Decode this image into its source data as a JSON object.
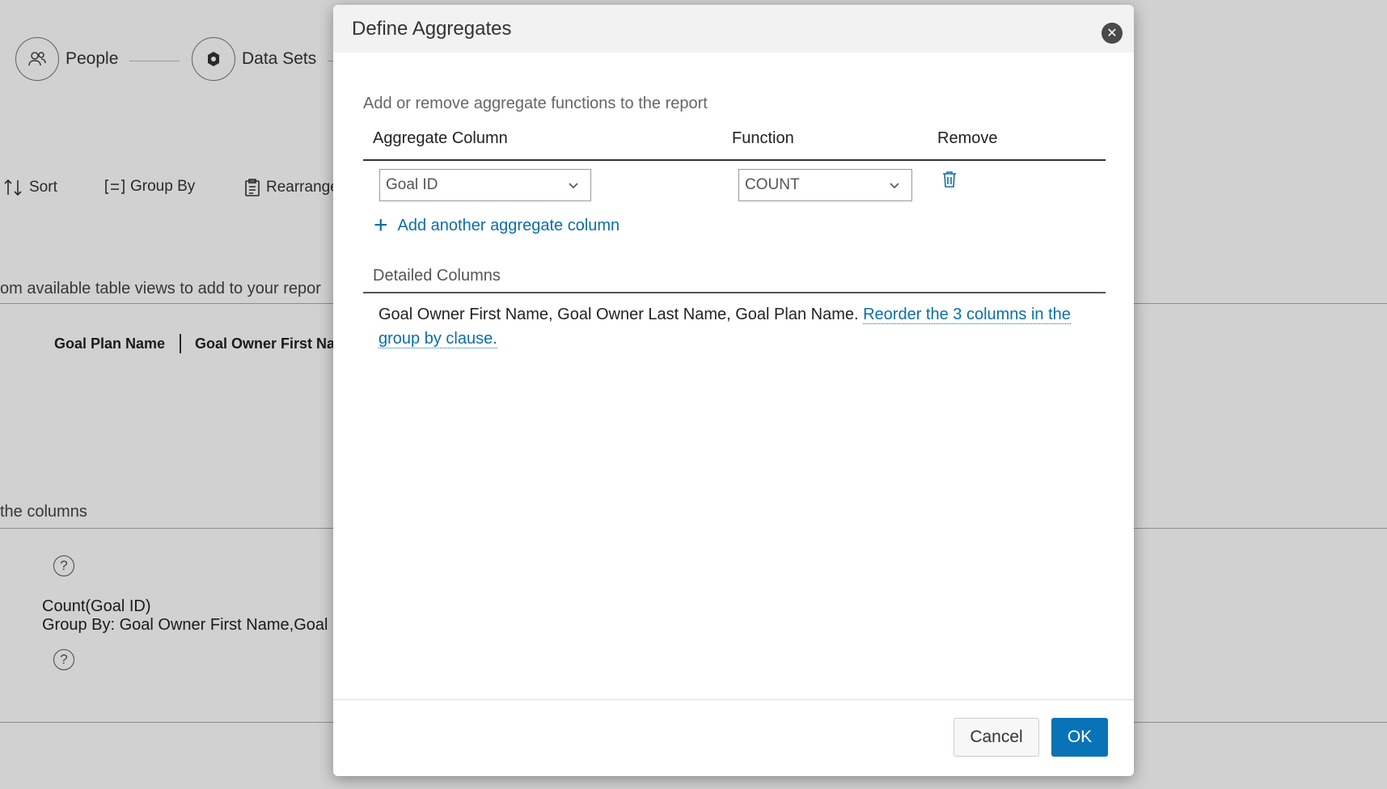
{
  "background": {
    "steps": [
      {
        "label": "People",
        "icon": "people-icon"
      },
      {
        "label": "Data Sets",
        "icon": "data-sets-icon"
      }
    ],
    "toolbar": {
      "sort": "Sort",
      "group_by": "Group By",
      "rearrange": "Rearrange"
    },
    "instruction_text": "om available table views to add to your repor",
    "columns": [
      "Goal Plan Name",
      "Goal Owner First Na"
    ],
    "columns_hint": " the columns",
    "summary_line1": "Count(Goal ID)",
    "summary_line2": "Group By: Goal Owner First Name,Goal C",
    "help_glyph": "?"
  },
  "dialog": {
    "title": "Define Aggregates",
    "close_glyph": "✕",
    "description": "Add or remove aggregate functions to the report",
    "headers": {
      "aggregate_column": "Aggregate Column",
      "function": "Function",
      "remove": "Remove"
    },
    "row": {
      "aggregate_column_value": "Goal ID",
      "function_value": "COUNT"
    },
    "add_link": "Add another aggregate column",
    "detailed_columns": {
      "title": "Detailed Columns",
      "text": "Goal Owner First Name, Goal Owner Last Name, Goal Plan Name. ",
      "link": "Reorder the 3 columns in the group by clause."
    },
    "buttons": {
      "cancel": "Cancel",
      "ok": "OK"
    }
  },
  "colors": {
    "link": "#0b6ea8",
    "primary_button": "#0a73b7"
  }
}
